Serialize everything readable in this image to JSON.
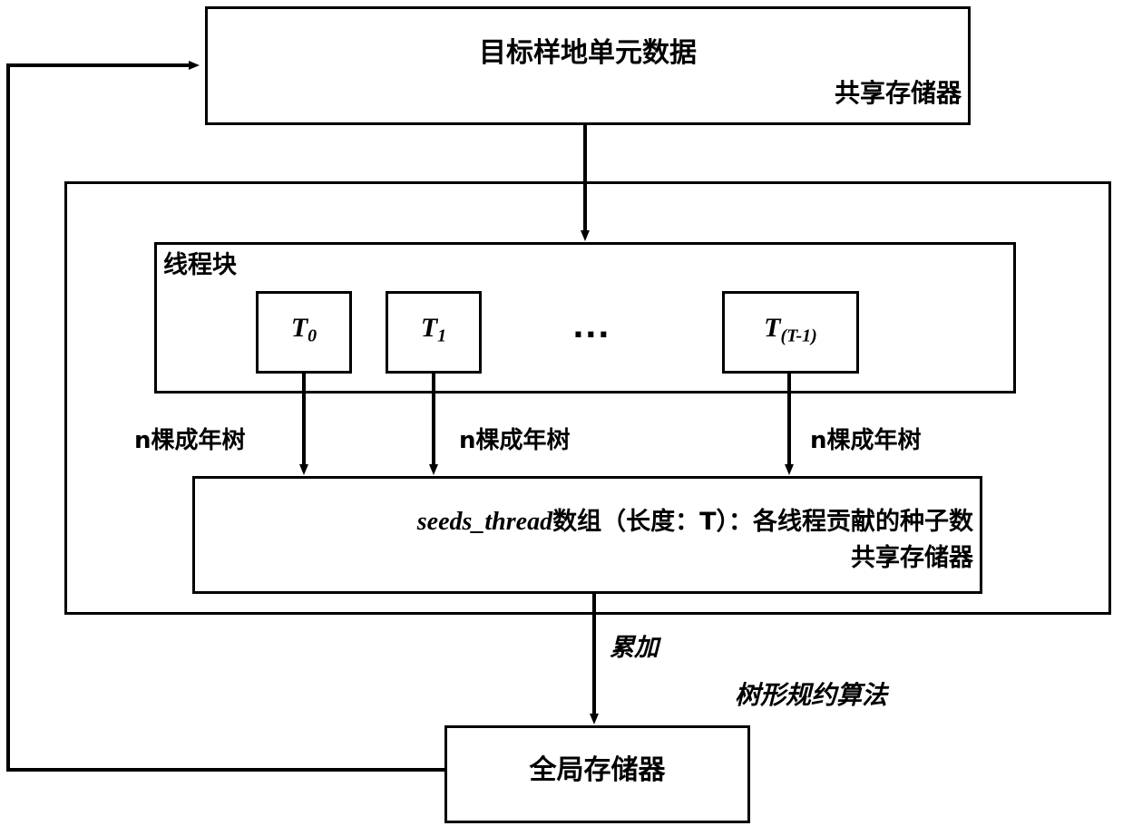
{
  "diagram": {
    "title_note": "CUDA thread block seed-count reduction flow diagram",
    "top_box": {
      "main_label": "目标样地单元数据",
      "memory_label": "共享存储器"
    },
    "outer_block": {
      "algorithm_label": "树形规约算法"
    },
    "thread_block": {
      "label": "线程块",
      "threads": [
        {
          "base": "T",
          "sub": "0"
        },
        {
          "base": "T",
          "sub": "1"
        },
        {
          "base": "T",
          "sub": "(T-1)"
        }
      ],
      "ellipsis": "..."
    },
    "edge_labels": {
      "tree_counts": [
        "n棵成年树",
        "n棵成年树",
        "n棵成年树"
      ],
      "accumulate": "累加"
    },
    "seeds_box": {
      "main_label": "seeds_thread数组（长度：T）：各线程贡献的种子数",
      "code_part": "seeds_thread",
      "text_part": "数组（长度：T）：各线程贡献的种子数",
      "memory_label": "共享存储器"
    },
    "global_box": {
      "label": "全局存储器"
    },
    "colors": {
      "stroke": "#000000",
      "background": "#ffffff",
      "text": "#000000"
    }
  }
}
